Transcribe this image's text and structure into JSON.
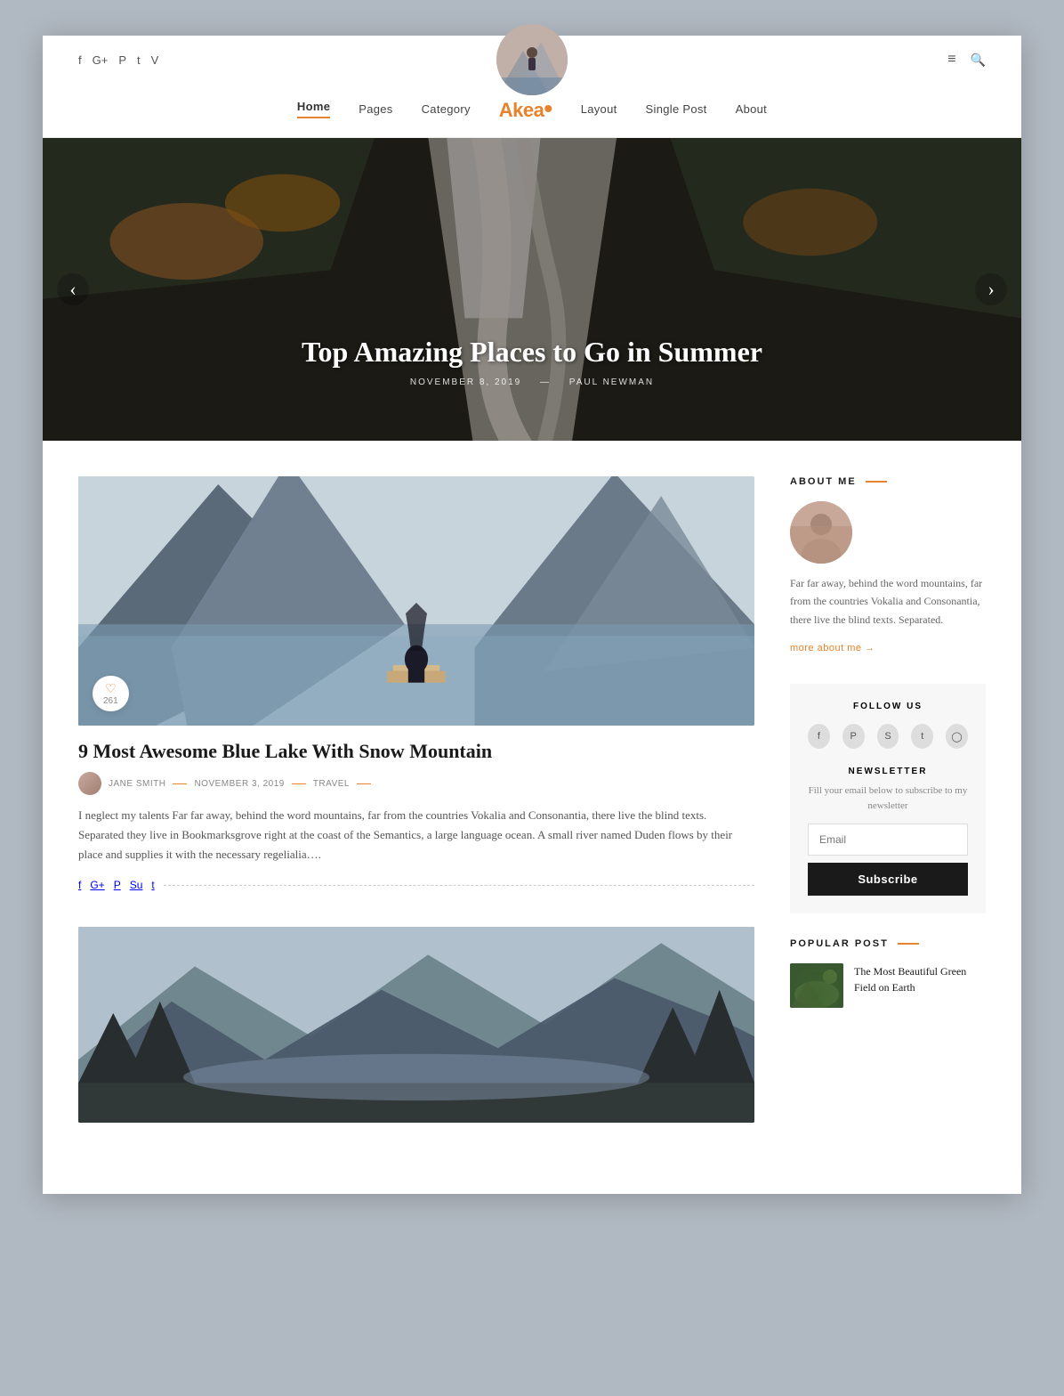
{
  "header": {
    "social_links": [
      "f",
      "G+",
      "P",
      "t",
      "V"
    ],
    "logo_alt": "Blog Logo",
    "menu_icon": "≡",
    "search_icon": "🔍"
  },
  "nav": {
    "links": [
      "Home",
      "Pages",
      "Category"
    ],
    "brand": "Ak",
    "brand_highlight": "ea",
    "brand_dot": "•",
    "links_right": [
      "Layout",
      "Single Post",
      "About"
    ],
    "active": "Home"
  },
  "hero": {
    "title": "Top Amazing Places to Go in Summer",
    "date": "NOVEMBER 8, 2019",
    "author": "PAUL NEWMAN",
    "prev_label": "‹",
    "next_label": "›"
  },
  "post1": {
    "like_icon": "♡",
    "like_count": "261",
    "title": "9 Most Awesome Blue Lake With Snow Mountain",
    "author_name": "JANE SMITH",
    "date": "NOVEMBER 3, 2019",
    "category": "TRAVEL",
    "excerpt": "I neglect my talents Far far away, behind the word mountains, far from the countries Vokalia and Consonantia, there live the blind texts. Separated they live in Bookmarksgrove right at the coast of the Semantics, a large language ocean. A small river named Duden flows by their place and supplies it with the necessary regelialia….",
    "social": [
      "f",
      "G+",
      "P",
      "Su",
      "t"
    ]
  },
  "sidebar": {
    "about_title": "ABOUT ME",
    "about_text": "Far far away, behind the word mountains, far from the countries Vokalia and Consonantia, there live the blind texts. Separated.",
    "more_link": "more about me →",
    "follow_title": "FOLLOW US",
    "follow_icons": [
      "f",
      "P",
      "S",
      "t",
      "◯"
    ],
    "newsletter_title": "NEWSLETTER",
    "newsletter_desc": "Fill your email below to subscribe to my newsletter",
    "email_placeholder": "Email",
    "subscribe_btn": "Subscribe",
    "popular_title": "POPULAR POST",
    "popular_item_title": "The Most Beautiful Green Field on Earth"
  }
}
